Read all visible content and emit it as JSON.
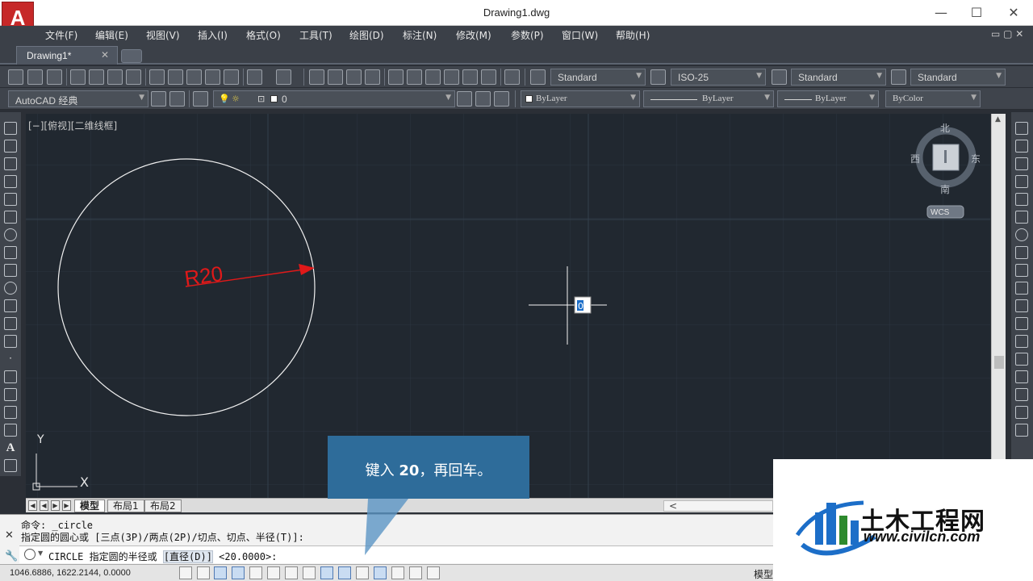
{
  "window": {
    "title": "Drawing1.dwg",
    "minimize": "—",
    "maximize": "☐",
    "close": "✕",
    "logo_letter": "A"
  },
  "menu": {
    "items": [
      "文件(F)",
      "编辑(E)",
      "视图(V)",
      "插入(I)",
      "格式(O)",
      "工具(T)",
      "绘图(D)",
      "标注(N)",
      "修改(M)",
      "参数(P)",
      "窗口(W)",
      "帮助(H)"
    ],
    "mdi_controls": "▭ ▢ ✕"
  },
  "tabs": {
    "document": "Drawing1*",
    "close": "✕"
  },
  "toolbar": {
    "text_style": "Standard",
    "dim_style": "ISO-25",
    "table_style": "Standard",
    "multileader_style": "Standard",
    "workspace": "AutoCAD 经典",
    "layer_name": "0",
    "color": "ByLayer",
    "linetype": "ByLayer",
    "lineweight": "ByLayer",
    "plot_style": "ByColor"
  },
  "viewport": {
    "label": "[−][俯视][二维线框]",
    "dimension_label": "R20",
    "cursor_input": "0",
    "ucs_x": "X",
    "ucs_y": "Y"
  },
  "viewcube": {
    "north": "北",
    "south": "南",
    "east": "东",
    "west": "西",
    "wcs": "WCS"
  },
  "layout_tabs": {
    "model": "模型",
    "layout1": "布局1",
    "layout2": "布局2",
    "scroll_left": "<"
  },
  "command": {
    "history_1": "命令:  _circle",
    "history_2": "指定圆的圆心或 [三点(3P)/两点(2P)/切点、切点、半径(T)]:",
    "prompt_prefix": "CIRCLE 指定圆的半径或 ",
    "prompt_option": "[直径(D)]",
    "prompt_suffix": " <20.0000>:"
  },
  "status": {
    "coords": "1046.6886, 1622.2144, 0.0000",
    "model": "模型"
  },
  "callout": {
    "text_before": "键入 ",
    "text_bold": "20",
    "text_after": "，再回车。"
  },
  "watermark": {
    "name": "土木工程网",
    "url": "www.civilcn.com"
  },
  "colors": {
    "canvas_bg": "#212830",
    "dimension_red": "#e01919",
    "callout_blue": "#2e6c9a",
    "accent_blue": "#1c6ec8"
  }
}
